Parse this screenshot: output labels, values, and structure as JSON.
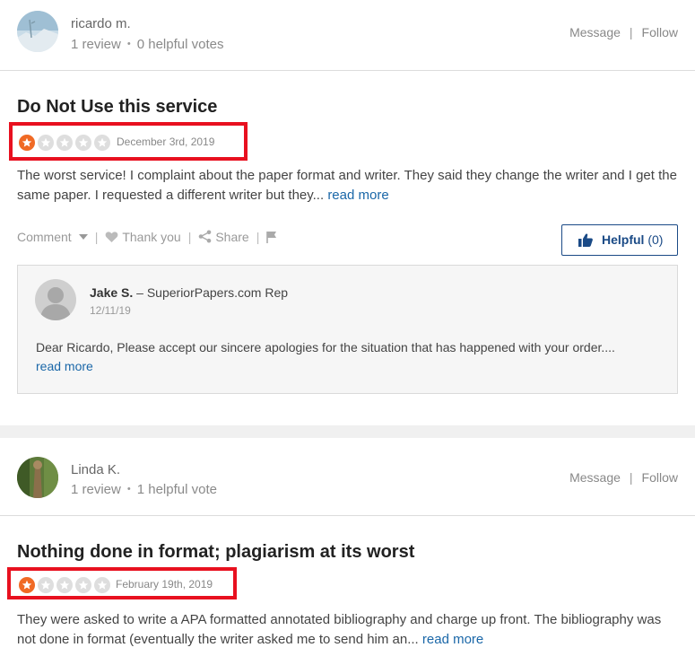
{
  "reviews": [
    {
      "user": {
        "name": "ricardo m.",
        "reviews": "1 review",
        "helpful_votes": "0 helpful votes",
        "avatar_icon": "landscape-photo-avatar"
      },
      "user_actions": {
        "message": "Message",
        "separator": "|",
        "follow": "Follow"
      },
      "title": "Do Not Use this service",
      "rating": 1,
      "rating_max": 5,
      "date": "December 3rd, 2019",
      "body": "The worst service! I complaint about the paper format and writer. They said they change the writer and I get the same paper. I requested a different writer but they...",
      "read_more": "read more",
      "actions": {
        "comment": "Comment",
        "thank_you": "Thank you",
        "share": "Share",
        "divider": "|"
      },
      "helpful_button": {
        "label": "Helpful",
        "count": "(0)"
      },
      "reply": {
        "name": "Jake S.",
        "role": " – SuperiorPapers.com Rep",
        "date": "12/11/19",
        "text": "Dear Ricardo, Please accept our sincere apologies for the situation that has happened with your order....",
        "read_more": "read more"
      }
    },
    {
      "user": {
        "name": "Linda K.",
        "reviews": "1 review",
        "helpful_votes": "1 helpful vote",
        "avatar_icon": "nature-photo-avatar"
      },
      "user_actions": {
        "message": "Message",
        "separator": "|",
        "follow": "Follow"
      },
      "title": "Nothing done in format; plagiarism at its worst",
      "rating": 1,
      "rating_max": 5,
      "date": "February 19th, 2019",
      "body": "They were asked to write a APA formatted annotated bibliography and charge up front. The bibliography was not done in format (eventually the writer asked me to send him an...",
      "read_more": "read more"
    }
  ],
  "colors": {
    "highlight_box": "#e8101f",
    "star_filled": "#f06a25",
    "star_empty": "#dedede",
    "link": "#1a67a8",
    "helpful_button": "#1a4a86"
  }
}
